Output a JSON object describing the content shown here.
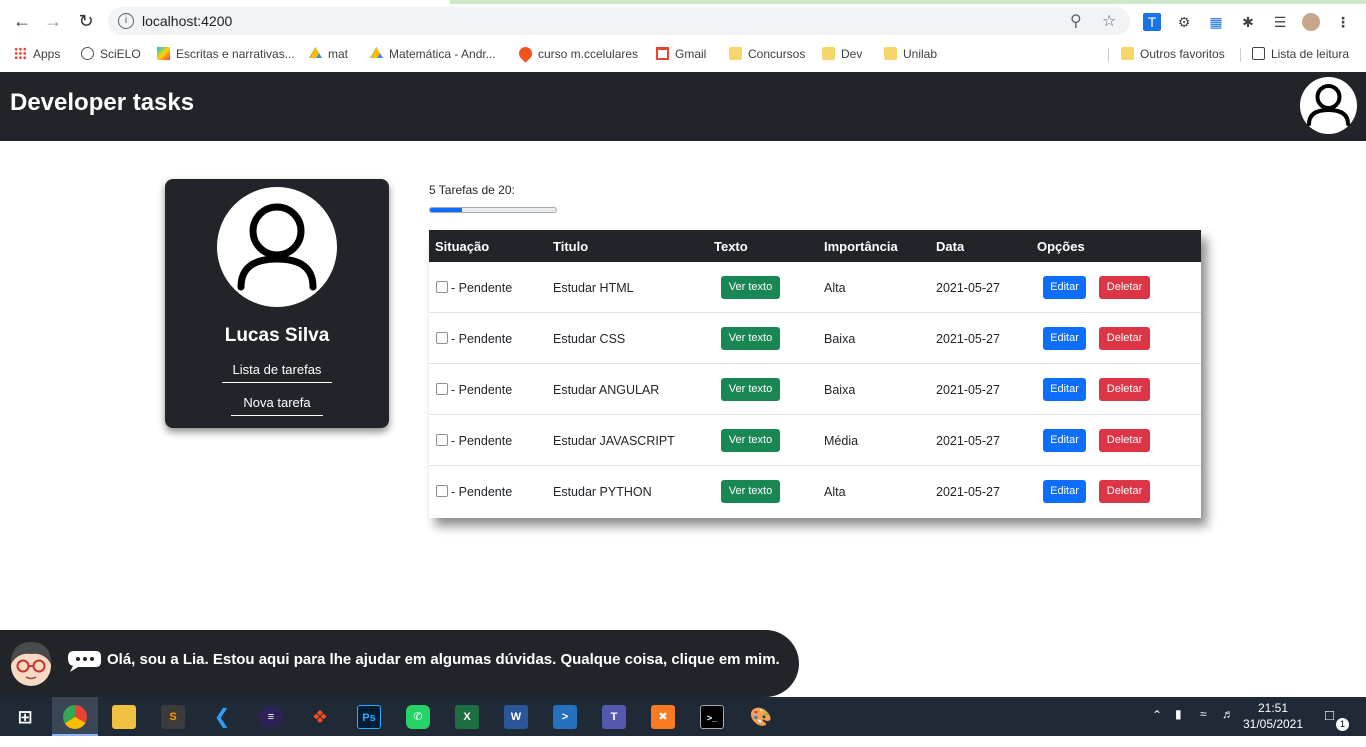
{
  "browser": {
    "url": "localhost:4200",
    "bookmarks": [
      {
        "label": "Apps"
      },
      {
        "label": "SciELO"
      },
      {
        "label": "Escritas e narrativas..."
      },
      {
        "label": "mat"
      },
      {
        "label": "Matemática - Andr..."
      },
      {
        "label": "curso m.ccelulares"
      },
      {
        "label": "Gmail"
      },
      {
        "label": "Concursos"
      },
      {
        "label": "Dev"
      },
      {
        "label": "Unilab"
      }
    ],
    "other_favorites": "Outros favoritos",
    "reading_list": "Lista de leitura"
  },
  "header": {
    "title": "Developer tasks"
  },
  "profile": {
    "name": "Lucas Silva",
    "links": [
      "Lista de tarefas",
      "Nova tarefa"
    ]
  },
  "progress": {
    "label": "5 Tarefas de 20:",
    "done": 5,
    "total": 20,
    "color": "#0d6efd"
  },
  "table": {
    "headers": [
      "Situação",
      "Titulo",
      "Texto",
      "Importância",
      "Data",
      "Opções"
    ],
    "rows": [
      {
        "status": "- Pendente",
        "title": "Estudar HTML",
        "text_button": "Ver texto",
        "importance": "Alta",
        "date": "2021-05-27",
        "edit": "Editar",
        "delete": "Deletar"
      },
      {
        "status": "- Pendente",
        "title": "Estudar CSS",
        "text_button": "Ver texto",
        "importance": "Baixa",
        "date": "2021-05-27",
        "edit": "Editar",
        "delete": "Deletar"
      },
      {
        "status": "- Pendente",
        "title": "Estudar ANGULAR",
        "text_button": "Ver texto",
        "importance": "Baixa",
        "date": "2021-05-27",
        "edit": "Editar",
        "delete": "Deletar"
      },
      {
        "status": "- Pendente",
        "title": "Estudar JAVASCRIPT",
        "text_button": "Ver texto",
        "importance": "Média",
        "date": "2021-05-27",
        "edit": "Editar",
        "delete": "Deletar"
      },
      {
        "status": "- Pendente",
        "title": "Estudar PYTHON",
        "text_button": "Ver texto",
        "importance": "Alta",
        "date": "2021-05-27",
        "edit": "Editar",
        "delete": "Deletar"
      }
    ]
  },
  "assistant": {
    "message": "Olá, sou a Lia. Estou aqui para lhe ajudar em algumas dúvidas. Qualque coisa, clique em mim."
  },
  "taskbar": {
    "apps": [
      "windows-start-icon",
      "chrome-icon",
      "file-explorer-icon",
      "sublime-icon",
      "vscode-icon",
      "eclipse-icon",
      "figma-icon",
      "photoshop-icon",
      "whatsapp-icon",
      "excel-icon",
      "word-icon",
      "powershell-icon",
      "teams-icon",
      "xampp-icon",
      "terminal-icon",
      "paint-icon"
    ],
    "time": "21:51",
    "date": "31/05/2021",
    "notifications": "1"
  }
}
